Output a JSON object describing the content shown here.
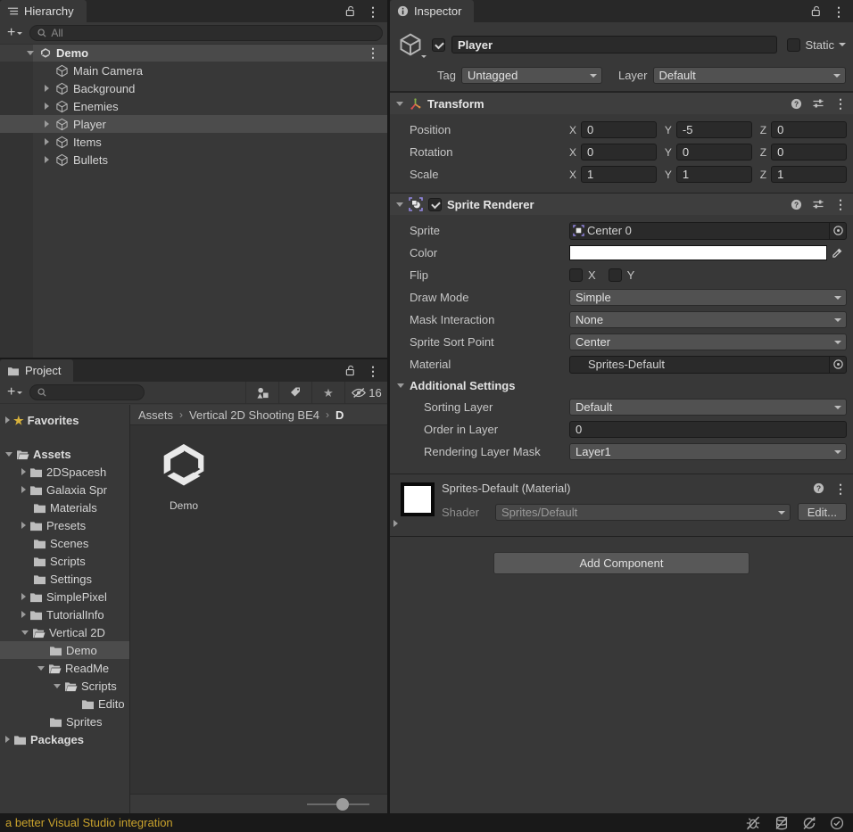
{
  "colors": {
    "panel_bg": "#383838",
    "selection": "#4C4C4C",
    "status_link": "#C9A22C"
  },
  "hierarchy": {
    "tab_label": "Hierarchy",
    "create_label": "+",
    "search_placeholder": "All",
    "scene": {
      "name": "Demo"
    },
    "items": [
      {
        "label": "Main Camera"
      },
      {
        "label": "Background"
      },
      {
        "label": "Enemies"
      },
      {
        "label": "Player"
      },
      {
        "label": "Items"
      },
      {
        "label": "Bullets"
      }
    ]
  },
  "project": {
    "tab_label": "Project",
    "create_label": "+",
    "search_placeholder": "",
    "hidden_count": "16",
    "favorites_label": "Favorites",
    "tree": [
      {
        "label": "Assets"
      },
      {
        "label": "2DSpacesh"
      },
      {
        "label": "Galaxia Spr"
      },
      {
        "label": "Materials"
      },
      {
        "label": "Presets"
      },
      {
        "label": "Scenes"
      },
      {
        "label": "Scripts"
      },
      {
        "label": "Settings"
      },
      {
        "label": "SimplePixel"
      },
      {
        "label": "TutorialInfo"
      },
      {
        "label": "Vertical 2D"
      },
      {
        "label": "Demo"
      },
      {
        "label": "ReadMe"
      },
      {
        "label": "Scripts"
      },
      {
        "label": "Edito"
      },
      {
        "label": "Sprites"
      },
      {
        "label": "Packages"
      }
    ],
    "breadcrumb": {
      "items": [
        "Assets",
        "Vertical 2D Shooting BE4",
        "D"
      ],
      "separator": "›"
    },
    "content_item_label": "Demo"
  },
  "inspector": {
    "tab_label": "Inspector",
    "header": {
      "name_value": "Player",
      "static_label": "Static",
      "tag_label": "Tag",
      "tag_value": "Untagged",
      "layer_label": "Layer",
      "layer_value": "Default"
    },
    "transform": {
      "title": "Transform",
      "axis_x": "X",
      "axis_y": "Y",
      "axis_z": "Z",
      "position": {
        "label": "Position",
        "x": "0",
        "y": "-5",
        "z": "0"
      },
      "rotation": {
        "label": "Rotation",
        "x": "0",
        "y": "0",
        "z": "0"
      },
      "scale": {
        "label": "Scale",
        "x": "1",
        "y": "1",
        "z": "1"
      }
    },
    "sprite_renderer": {
      "title": "Sprite Renderer",
      "sprite_label": "Sprite",
      "sprite_value": "Center 0",
      "color_label": "Color",
      "flip_label": "Flip",
      "flip_x_label": "X",
      "flip_y_label": "Y",
      "draw_mode_label": "Draw Mode",
      "draw_mode_value": "Simple",
      "mask_interaction_label": "Mask Interaction",
      "mask_interaction_value": "None",
      "sprite_sort_point_label": "Sprite Sort Point",
      "sprite_sort_point_value": "Center",
      "material_label": "Material",
      "material_value": "Sprites-Default",
      "additional_settings_label": "Additional Settings",
      "sorting_layer_label": "Sorting Layer",
      "sorting_layer_value": "Default",
      "order_in_layer_label": "Order in Layer",
      "order_in_layer_value": "0",
      "rendering_layer_mask_label": "Rendering Layer Mask",
      "rendering_layer_mask_value": "Layer1"
    },
    "material_section": {
      "title": "Sprites-Default (Material)",
      "shader_label": "Shader",
      "shader_value": "Sprites/Default",
      "edit_button_label": "Edit..."
    },
    "add_component_label": "Add Component"
  },
  "statusbar": {
    "message": "a better Visual Studio integration"
  }
}
